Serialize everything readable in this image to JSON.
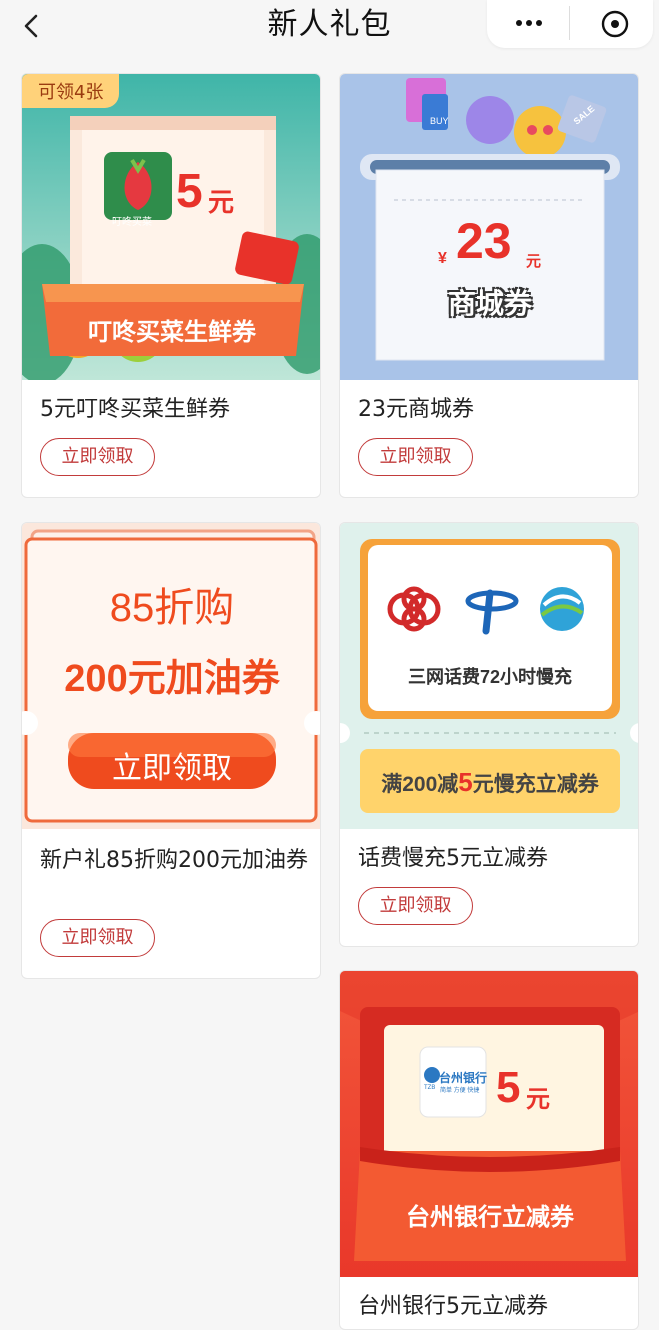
{
  "header": {
    "title": "新人礼包",
    "back_icon": "back-arrow-icon",
    "more_icon": "more-dots-icon",
    "close_icon": "close-circle-icon"
  },
  "cards": [
    {
      "banner": {
        "tag": "可领4张",
        "brand": "叮咚买菜",
        "amount": "5",
        "unit": "元",
        "ribbon": "叮咚买菜生鲜券"
      },
      "title": "5元叮咚买菜生鲜券",
      "button": "立即领取"
    },
    {
      "banner": {
        "currency": "¥",
        "amount": "23",
        "unit": "元",
        "label": "商城券",
        "sale_tag": "SALE",
        "buy": "BUY"
      },
      "title": "23元商城券",
      "button": "立即领取"
    },
    {
      "banner": {
        "line1": "85折购",
        "line2": "200元加油券",
        "cta": "立即领取"
      },
      "title": "新户礼85折购200元加油券",
      "button": "立即领取"
    },
    {
      "banner": {
        "caption": "三网话费72小时慢充",
        "offer_prefix": "满200减",
        "offer_amount": "5",
        "offer_suffix": "元慢充立减券"
      },
      "title": "话费慢充5元立减券",
      "button": "立即领取"
    },
    {
      "banner": {
        "bank_name": "台州银行",
        "bank_abbr": "TZB",
        "bank_slogan": "简单 方便 快捷",
        "amount": "5",
        "unit": "元",
        "ribbon": "台州银行立减券"
      },
      "title": "台州银行5元立减券"
    }
  ]
}
